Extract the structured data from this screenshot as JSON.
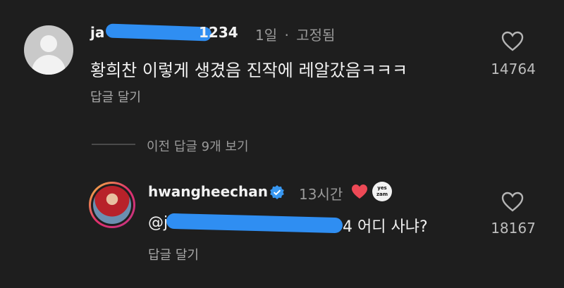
{
  "comment1": {
    "username_start": "ja",
    "username_end": "1234",
    "time": "1일",
    "separator": "·",
    "pinned": "고정됨",
    "text": "황희찬 이렇게 생겼음 진작에 레알갔음ㅋㅋㅋ",
    "reply_label": "답글 달기",
    "like_count": "14764"
  },
  "view_previous_replies": "이전 답글 9개 보기",
  "comment2": {
    "username": "hwangheechan",
    "time": "13시간",
    "badge_text": "yes zam",
    "mention_start": "@j",
    "text_end": "4 어디 사냐?",
    "reply_label": "답글 달기",
    "like_count": "18167"
  },
  "colors": {
    "background": "#1e1e1e",
    "redaction": "#2f8ef2",
    "verified": "#3897f0",
    "like_heart": "#ed4956"
  }
}
